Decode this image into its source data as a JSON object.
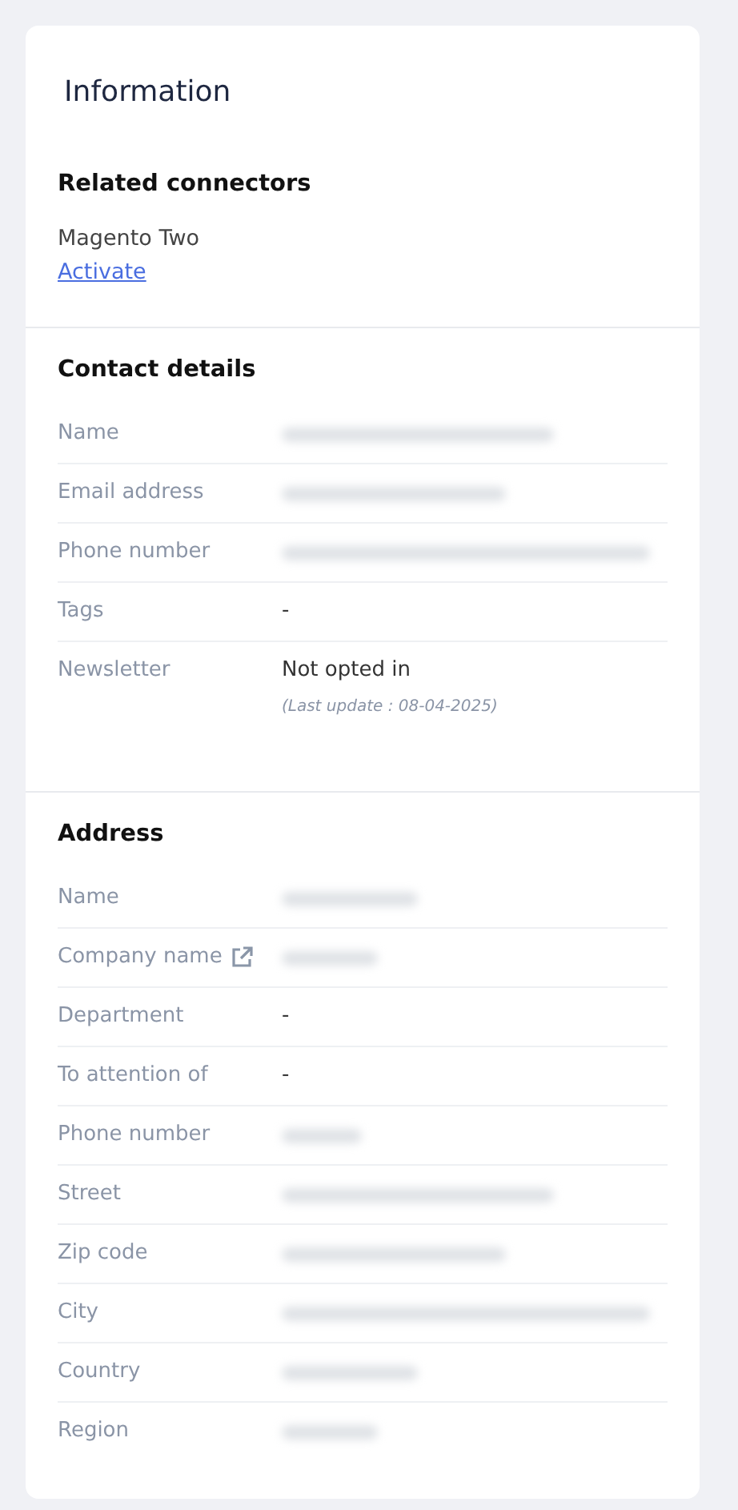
{
  "card": {
    "title": "Information"
  },
  "connectors": {
    "heading": "Related connectors",
    "name": "Magento Two",
    "action": "Activate"
  },
  "contact": {
    "heading": "Contact details",
    "rows": [
      {
        "label": "Name",
        "kind": "redacted"
      },
      {
        "label": "Email address",
        "kind": "redacted"
      },
      {
        "label": "Phone number",
        "kind": "redacted"
      },
      {
        "label": "Tags",
        "kind": "text",
        "value": "-"
      },
      {
        "label": "Newsletter",
        "kind": "text",
        "value": "Not opted in",
        "note": "(Last update : 08-04-2025)"
      }
    ]
  },
  "address": {
    "heading": "Address",
    "rows": [
      {
        "label": "Name",
        "kind": "redacted"
      },
      {
        "label": "Company name",
        "kind": "redacted",
        "external_link": true
      },
      {
        "label": "Department",
        "kind": "text",
        "value": "-"
      },
      {
        "label": "To attention of",
        "kind": "text",
        "value": "-"
      },
      {
        "label": "Phone number",
        "kind": "redacted"
      },
      {
        "label": "Street",
        "kind": "redacted"
      },
      {
        "label": "Zip code",
        "kind": "redacted"
      },
      {
        "label": "City",
        "kind": "redacted"
      },
      {
        "label": "Country",
        "kind": "redacted"
      },
      {
        "label": "Region",
        "kind": "redacted"
      }
    ]
  }
}
